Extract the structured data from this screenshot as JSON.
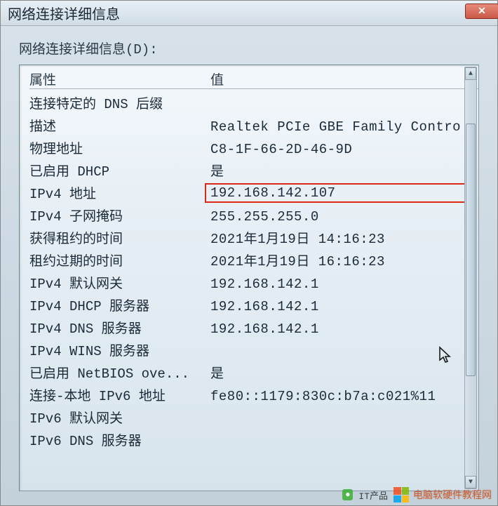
{
  "window": {
    "title": "网络连接详细信息"
  },
  "section_label": "网络连接详细信息(D):",
  "columns": {
    "property": "属性",
    "value": "值"
  },
  "rows": [
    {
      "prop": "连接特定的 DNS 后缀",
      "val": ""
    },
    {
      "prop": "描述",
      "val": "Realtek PCIe GBE Family Contro"
    },
    {
      "prop": "物理地址",
      "val": "C8-1F-66-2D-46-9D"
    },
    {
      "prop": "已启用 DHCP",
      "val": "是"
    },
    {
      "prop": "IPv4 地址",
      "val": "192.168.142.107",
      "highlight": true
    },
    {
      "prop": "IPv4 子网掩码",
      "val": "255.255.255.0"
    },
    {
      "prop": "获得租约的时间",
      "val": "2021年1月19日 14:16:23"
    },
    {
      "prop": "租约过期的时间",
      "val": "2021年1月19日 16:16:23"
    },
    {
      "prop": "IPv4 默认网关",
      "val": "192.168.142.1"
    },
    {
      "prop": "IPv4 DHCP 服务器",
      "val": "192.168.142.1"
    },
    {
      "prop": "IPv4 DNS 服务器",
      "val": "192.168.142.1"
    },
    {
      "prop": "IPv4 WINS 服务器",
      "val": ""
    },
    {
      "prop": "已启用 NetBIOS ove...",
      "val": "是"
    },
    {
      "prop": "连接-本地 IPv6 地址",
      "val": "fe80::1179:830c:b7a:c021%11"
    },
    {
      "prop": "IPv6 默认网关",
      "val": ""
    },
    {
      "prop": "IPv6 DNS 服务器",
      "val": ""
    }
  ],
  "watermark": {
    "pre": "IT产品",
    "main": "电脑软硬件教程网"
  }
}
